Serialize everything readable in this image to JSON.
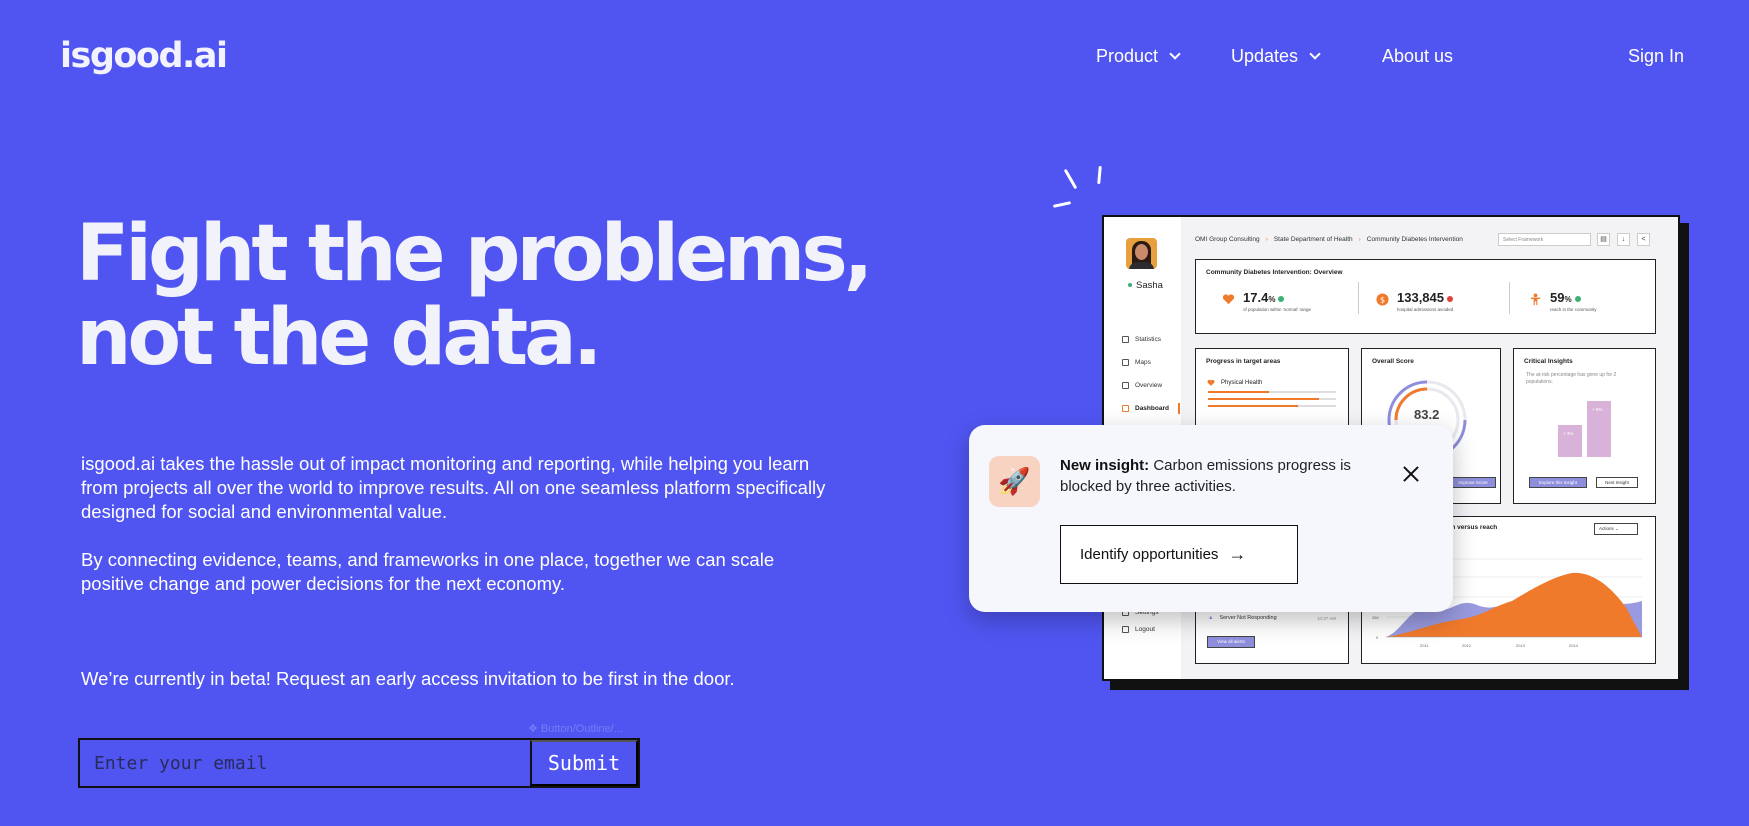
{
  "brand": {
    "logo": "isgood.ai"
  },
  "nav": {
    "product": "Product",
    "updates": "Updates",
    "about": "About us",
    "signin": "Sign In"
  },
  "hero": {
    "headline_line1": "Fight the problems,",
    "headline_line2": "not the data.",
    "para1": "isgood.ai takes the hassle out of impact monitoring and reporting, while helping you learn from projects all over the world to improve results. All on one seamless platform specifically designed for social and environmental value.",
    "para2": "By connecting evidence, teams, and frameworks in one place, together we can scale positive change and power decisions for the next economy.",
    "beta": "We’re currently in beta! Request an early access invitation to be first in the door."
  },
  "form": {
    "email_placeholder": "Enter your email",
    "submit_label": "Submit",
    "ghost_label": "❖ Button/Outline/..."
  },
  "dashboard": {
    "user_name": "Sasha",
    "sidebar": [
      "Statistics",
      "Maps",
      "Overview",
      "Dashboard"
    ],
    "sidebar_bottom": [
      "Settings",
      "Logout"
    ],
    "breadcrumbs": [
      "OMI Group Consulting",
      "State Department of Health",
      "Community Diabetes Intervention"
    ],
    "framework_select": "Select Framework",
    "overview_title": "Community Diabetes Intervention: Overview",
    "stats": [
      {
        "value": "17.4",
        "unit": "%",
        "label": "of population within 'normal' range",
        "icon": "heart-icon",
        "trend": "up"
      },
      {
        "value": "133,845",
        "unit": "",
        "label": "hospital admissions avoided",
        "icon": "dollar-icon",
        "trend": "down"
      },
      {
        "value": "59",
        "unit": "%",
        "label": "reach in the community",
        "icon": "person-icon",
        "trend": "up"
      }
    ],
    "progress_title": "Progress in target areas",
    "progress_item": "Physical Health",
    "progress_bars": [
      0.48,
      0.87,
      0.7
    ],
    "score_title": "Overall Score",
    "score_value": "83.2",
    "score_button": "Improve Score",
    "insights_title": "Critical Insights",
    "insights_sub": "The at-risk percentage has gone up for 2 populations.",
    "insight_pill_a": "+ 3%",
    "insight_pill_b": "+ 9%",
    "explore_button": "Explore this Insight",
    "next_button": "Next Insight",
    "alert_item": "Server Not Responding",
    "alert_time": "10:37 AM",
    "alerts_button": "View all alerts",
    "chart_title": "...on versus reach",
    "actions_label": "Actions",
    "chart_y_zero": "0",
    "chart_y_mid": "250",
    "chart_years": [
      "2011",
      "2012",
      "2013",
      "2014"
    ]
  },
  "toast": {
    "title": "New insight:",
    "body": " Carbon emissions progress is blocked by three activities.",
    "button": "Identify opportunities",
    "icon": "🚀"
  },
  "colors": {
    "background": "#5055F2",
    "accent_orange": "#F07A2C",
    "accent_purple": "#8E8FDC"
  }
}
